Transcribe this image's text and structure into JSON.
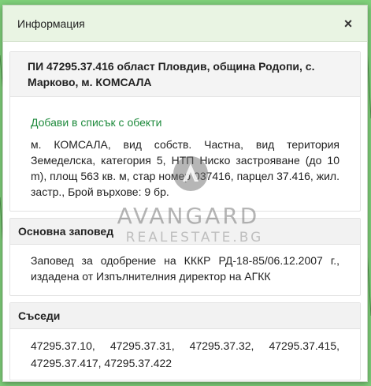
{
  "dialog": {
    "title": "Информация",
    "close_symbol": "×"
  },
  "parcel": {
    "heading": "ПИ 47295.37.416 област Пловдив, община Родопи, с. Марково, м. КОМСАЛА",
    "add_link": "Добави в списък с обекти",
    "description": "м. КОМСАЛА, вид собств. Частна, вид територия Земеделска, категория 5, НТП Ниско застрояване (до 10 m), площ 563 кв. м, стар номер 037416, парцел 37.416, жил. застр., Брой върхове: 9 бр."
  },
  "order": {
    "heading": "Основна заповед",
    "text": "Заповед за одобрение на КККР РД-18-85/06.12.2007 г., издадена от Изпълнителния директор на АГКК"
  },
  "neighbors": {
    "heading": "Съседи",
    "items": [
      "47295.37.10",
      "47295.37.31",
      "47295.37.32",
      "47295.37.415",
      "47295.37.417",
      "47295.37.422"
    ]
  },
  "watermark": {
    "main": "AVANGARD",
    "sub": "REALESTATE.BG"
  },
  "colors": {
    "map_background": "#7fd07a",
    "header_background": "#e9f4e3",
    "link": "#1e8a3c"
  }
}
